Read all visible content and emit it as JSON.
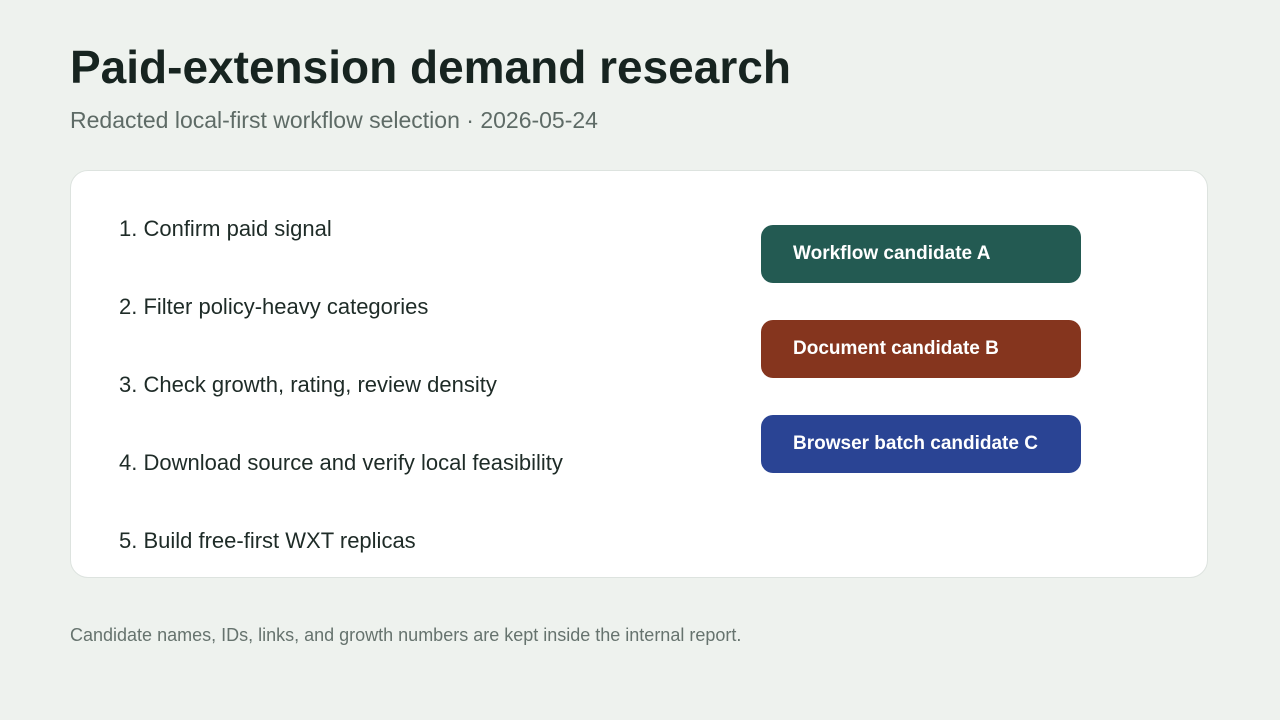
{
  "header": {
    "title": "Paid-extension demand research",
    "subtitle": "Redacted local-first workflow selection · 2026-05-24"
  },
  "steps": [
    "1. Confirm paid signal",
    "2. Filter policy-heavy categories",
    "3. Check growth, rating, review density",
    "4. Download source and verify local feasibility",
    "5. Build free-first WXT replicas"
  ],
  "candidates": [
    {
      "label": "Workflow candidate A",
      "color": "#235a52"
    },
    {
      "label": "Document candidate B",
      "color": "#85351e"
    },
    {
      "label": "Browser batch candidate C",
      "color": "#2a4494"
    }
  ],
  "footer": {
    "note": "Candidate names, IDs, links, and growth numbers are kept inside the internal report."
  }
}
